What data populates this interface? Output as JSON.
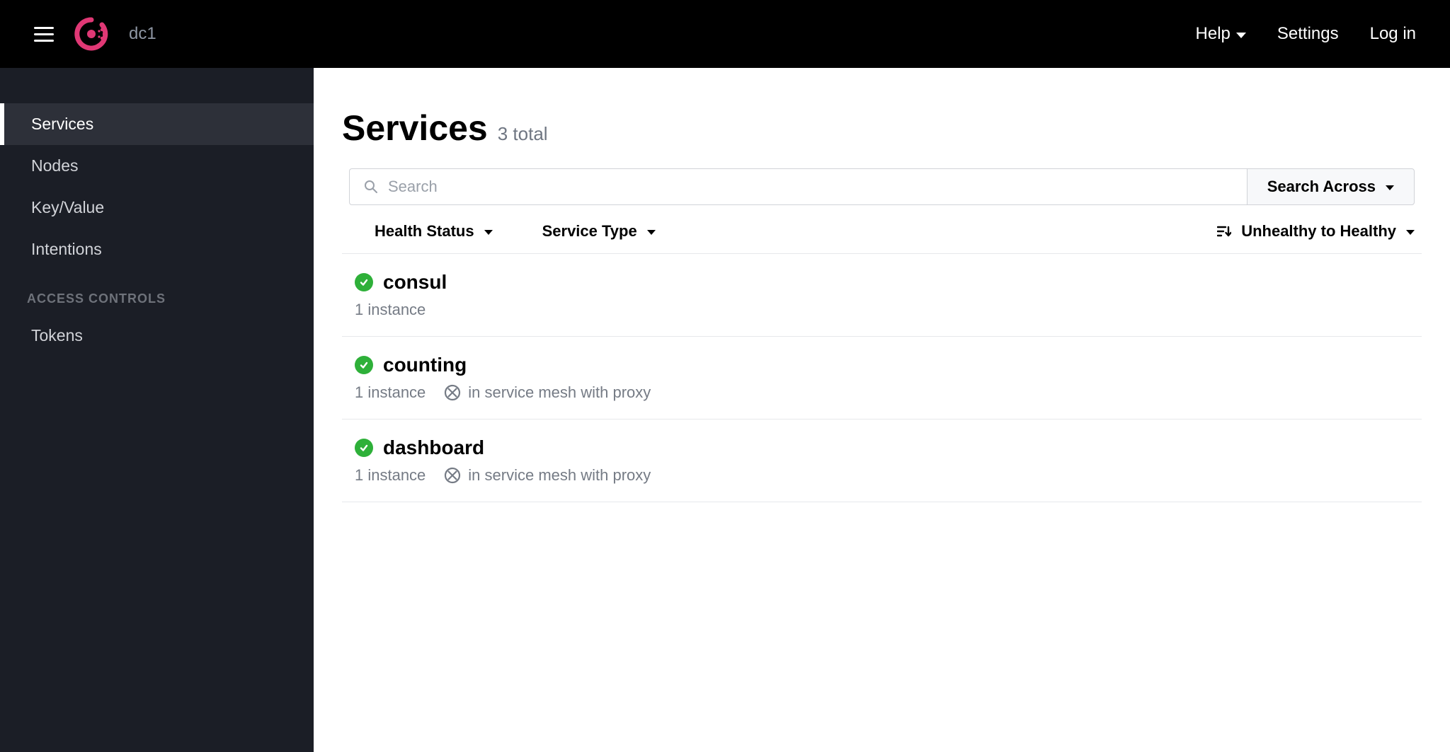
{
  "header": {
    "datacenter": "dc1",
    "help_label": "Help",
    "settings_label": "Settings",
    "login_label": "Log in"
  },
  "sidebar": {
    "items": [
      {
        "label": "Services",
        "active": true
      },
      {
        "label": "Nodes",
        "active": false
      },
      {
        "label": "Key/Value",
        "active": false
      },
      {
        "label": "Intentions",
        "active": false
      }
    ],
    "access_heading": "ACCESS CONTROLS",
    "access_items": [
      {
        "label": "Tokens"
      }
    ]
  },
  "page": {
    "title": "Services",
    "count_label": "3 total"
  },
  "search": {
    "placeholder": "Search",
    "across_label": "Search Across"
  },
  "filters": {
    "health_label": "Health Status",
    "type_label": "Service Type",
    "sort_label": "Unhealthy to Healthy"
  },
  "services": [
    {
      "name": "consul",
      "instances_label": "1 instance",
      "health": "passing",
      "mesh": false,
      "mesh_label": ""
    },
    {
      "name": "counting",
      "instances_label": "1 instance",
      "health": "passing",
      "mesh": true,
      "mesh_label": "in service mesh with proxy"
    },
    {
      "name": "dashboard",
      "instances_label": "1 instance",
      "health": "passing",
      "mesh": true,
      "mesh_label": "in service mesh with proxy"
    }
  ],
  "colors": {
    "accent": "#e03875",
    "health_ok": "#2eb039",
    "sidebar_bg": "#1b1e26",
    "header_bg": "#000000"
  }
}
